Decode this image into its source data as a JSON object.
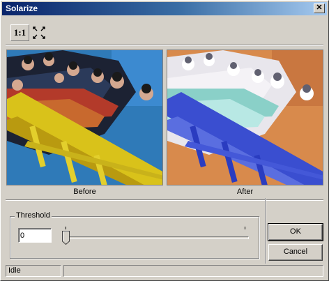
{
  "window": {
    "title": "Solarize"
  },
  "toolbar": {
    "actual_size_label": "1:1",
    "fit_icon": "fit-to-window-icon"
  },
  "previews": {
    "before_caption": "Before",
    "after_caption": "After"
  },
  "threshold": {
    "group_label": "Threshold",
    "value": "0",
    "slider_level": 0.0
  },
  "buttons": {
    "ok_label": "OK",
    "cancel_label": "Cancel"
  },
  "status": {
    "left": "Idle",
    "right": ""
  }
}
